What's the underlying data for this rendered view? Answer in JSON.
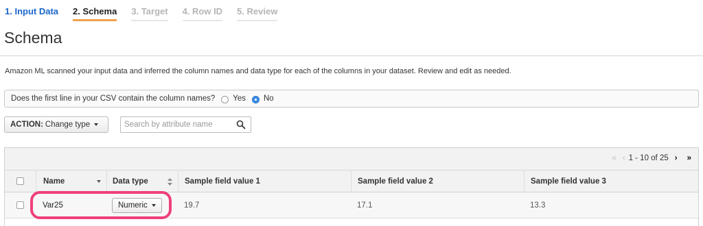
{
  "steps": [
    {
      "label": "1. Input Data",
      "state": "done"
    },
    {
      "label": "2. Schema",
      "state": "active"
    },
    {
      "label": "3. Target",
      "state": "future"
    },
    {
      "label": "4. Row ID",
      "state": "future"
    },
    {
      "label": "5. Review",
      "state": "future"
    }
  ],
  "page": {
    "title": "Schema",
    "description": "Amazon ML scanned your input data and inferred the column names and data type for each of the columns in your dataset. Review and edit as needed."
  },
  "question": {
    "text": "Does the first line in your CSV contain the column names?",
    "options": [
      "Yes",
      "No"
    ],
    "selected": "No"
  },
  "toolbar": {
    "action_prefix": "ACTION:",
    "action_label": "Change type",
    "search_placeholder": "Search by attribute name"
  },
  "pager": {
    "first": "«",
    "prev": "‹",
    "range": "1 - 10 of 25",
    "next": "›",
    "last": "»"
  },
  "table": {
    "headers": [
      "Name",
      "Data type",
      "Sample field value 1",
      "Sample field value 2",
      "Sample field value 3"
    ],
    "rows": [
      {
        "name": "Var25",
        "type": "Numeric",
        "s1": "19.7",
        "s2": "17.1",
        "s3": "13.3"
      }
    ]
  },
  "colors": {
    "step_done": "#1a66c9",
    "step_active_underline": "#f0a04b",
    "highlight": "#ee3f7d",
    "radio_selected": "#3a8ee6"
  }
}
